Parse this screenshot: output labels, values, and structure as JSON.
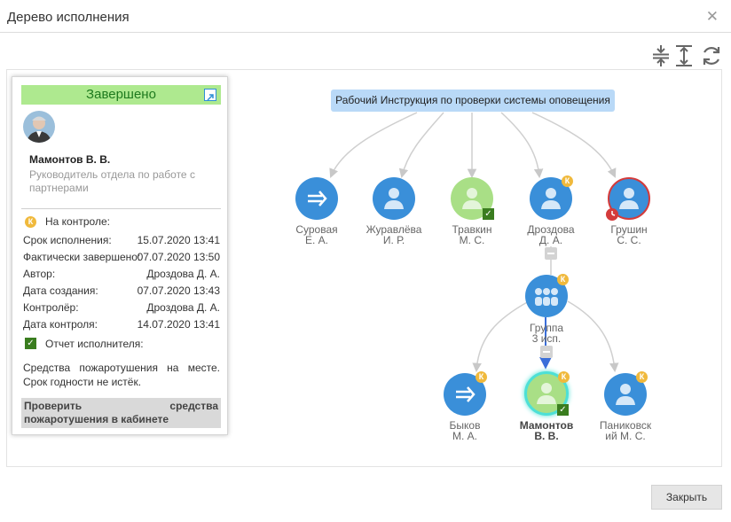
{
  "window": {
    "title": "Дерево исполнения"
  },
  "toolbar": {
    "icons": [
      "collapse-icon",
      "expand-icon",
      "refresh-icon"
    ]
  },
  "card": {
    "status": "Завершено",
    "name": "Мамонтов В. В.",
    "role": "Руководитель отдела по работе с партнерами",
    "k_letter": "К",
    "on_control_label": "На контроле:",
    "fields": [
      {
        "label": "Срок исполнения:",
        "value": "15.07.2020 13:41"
      },
      {
        "label": "Фактически завершено:",
        "value": "07.07.2020 13:50"
      },
      {
        "label": "Автор:",
        "value": "Дроздова Д. А."
      },
      {
        "label": "Дата создания:",
        "value": "07.07.2020 13:43"
      },
      {
        "label": "Контролёр:",
        "value": "Дроздова Д. А."
      },
      {
        "label": "Дата контроля:",
        "value": "14.07.2020 13:41"
      }
    ],
    "report_label": "Отчет исполнителя:",
    "report_text": "Средства пожаротушения на месте. Срок годности не истёк.",
    "task_text": "Проверить средства пожаротушения в кабинете"
  },
  "tree": {
    "root": "Рабочий Инструкция по проверки системы оповещения",
    "nodes": [
      {
        "line1": "Суровая",
        "line2": "Е. А."
      },
      {
        "line1": "Журавлёва",
        "line2": "И. Р."
      },
      {
        "line1": "Травкин",
        "line2": "М. С."
      },
      {
        "line1": "Дроздова",
        "line2": "Д. А."
      },
      {
        "line1": "Грушин",
        "line2": "С. С."
      },
      {
        "line1": "Группа",
        "line2": "3 исп."
      },
      {
        "line1": "Быков",
        "line2": "М. А."
      },
      {
        "line1": "Мамонтов",
        "line2": "В. В."
      },
      {
        "line1": "Паниковск",
        "line2": "ий М. С."
      }
    ]
  },
  "colors": {
    "node_blue": "#3a8fd9",
    "node_green": "#a9df86",
    "accent_red": "#d43b3b",
    "k_orange": "#f0b93c",
    "status_green": "#aee98f"
  },
  "buttons": {
    "close": "Закрыть"
  }
}
